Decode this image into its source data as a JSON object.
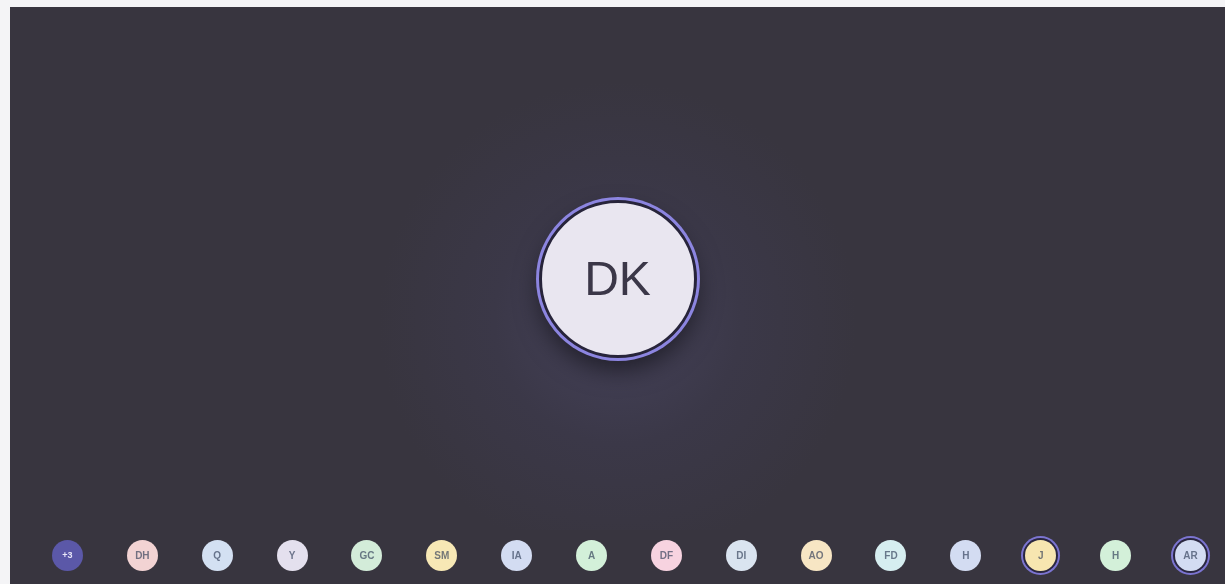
{
  "main_avatar": {
    "initials": "DK"
  },
  "avatars": [
    {
      "initials": "+3",
      "kind": "overflow",
      "color": "#5b58a8",
      "ringed": false
    },
    {
      "initials": "DH",
      "kind": "person",
      "color": "#f2d3d3",
      "ringed": false
    },
    {
      "initials": "Q",
      "kind": "person",
      "color": "#d3e0f2",
      "ringed": false
    },
    {
      "initials": "Y",
      "kind": "person",
      "color": "#e4e0ee",
      "ringed": false
    },
    {
      "initials": "GC",
      "kind": "person",
      "color": "#d3ecd9",
      "ringed": false
    },
    {
      "initials": "SM",
      "kind": "person",
      "color": "#f7e8b5",
      "ringed": false
    },
    {
      "initials": "IA",
      "kind": "person",
      "color": "#d3dcf2",
      "ringed": false
    },
    {
      "initials": "A",
      "kind": "person",
      "color": "#d3f0d9",
      "ringed": false
    },
    {
      "initials": "DF",
      "kind": "person",
      "color": "#f7d3e0",
      "ringed": false
    },
    {
      "initials": "DI",
      "kind": "person",
      "color": "#dae4f0",
      "ringed": false
    },
    {
      "initials": "AO",
      "kind": "person",
      "color": "#f7e6c4",
      "ringed": false
    },
    {
      "initials": "FD",
      "kind": "person",
      "color": "#d6eef0",
      "ringed": false
    },
    {
      "initials": "H",
      "kind": "person",
      "color": "#d3dcf2",
      "ringed": false
    },
    {
      "initials": "J",
      "kind": "person",
      "color": "#f7e6b0",
      "ringed": true
    },
    {
      "initials": "H",
      "kind": "person",
      "color": "#d3f0d9",
      "ringed": false
    },
    {
      "initials": "AR",
      "kind": "person",
      "color": "#d3dcf2",
      "ringed": true
    }
  ]
}
